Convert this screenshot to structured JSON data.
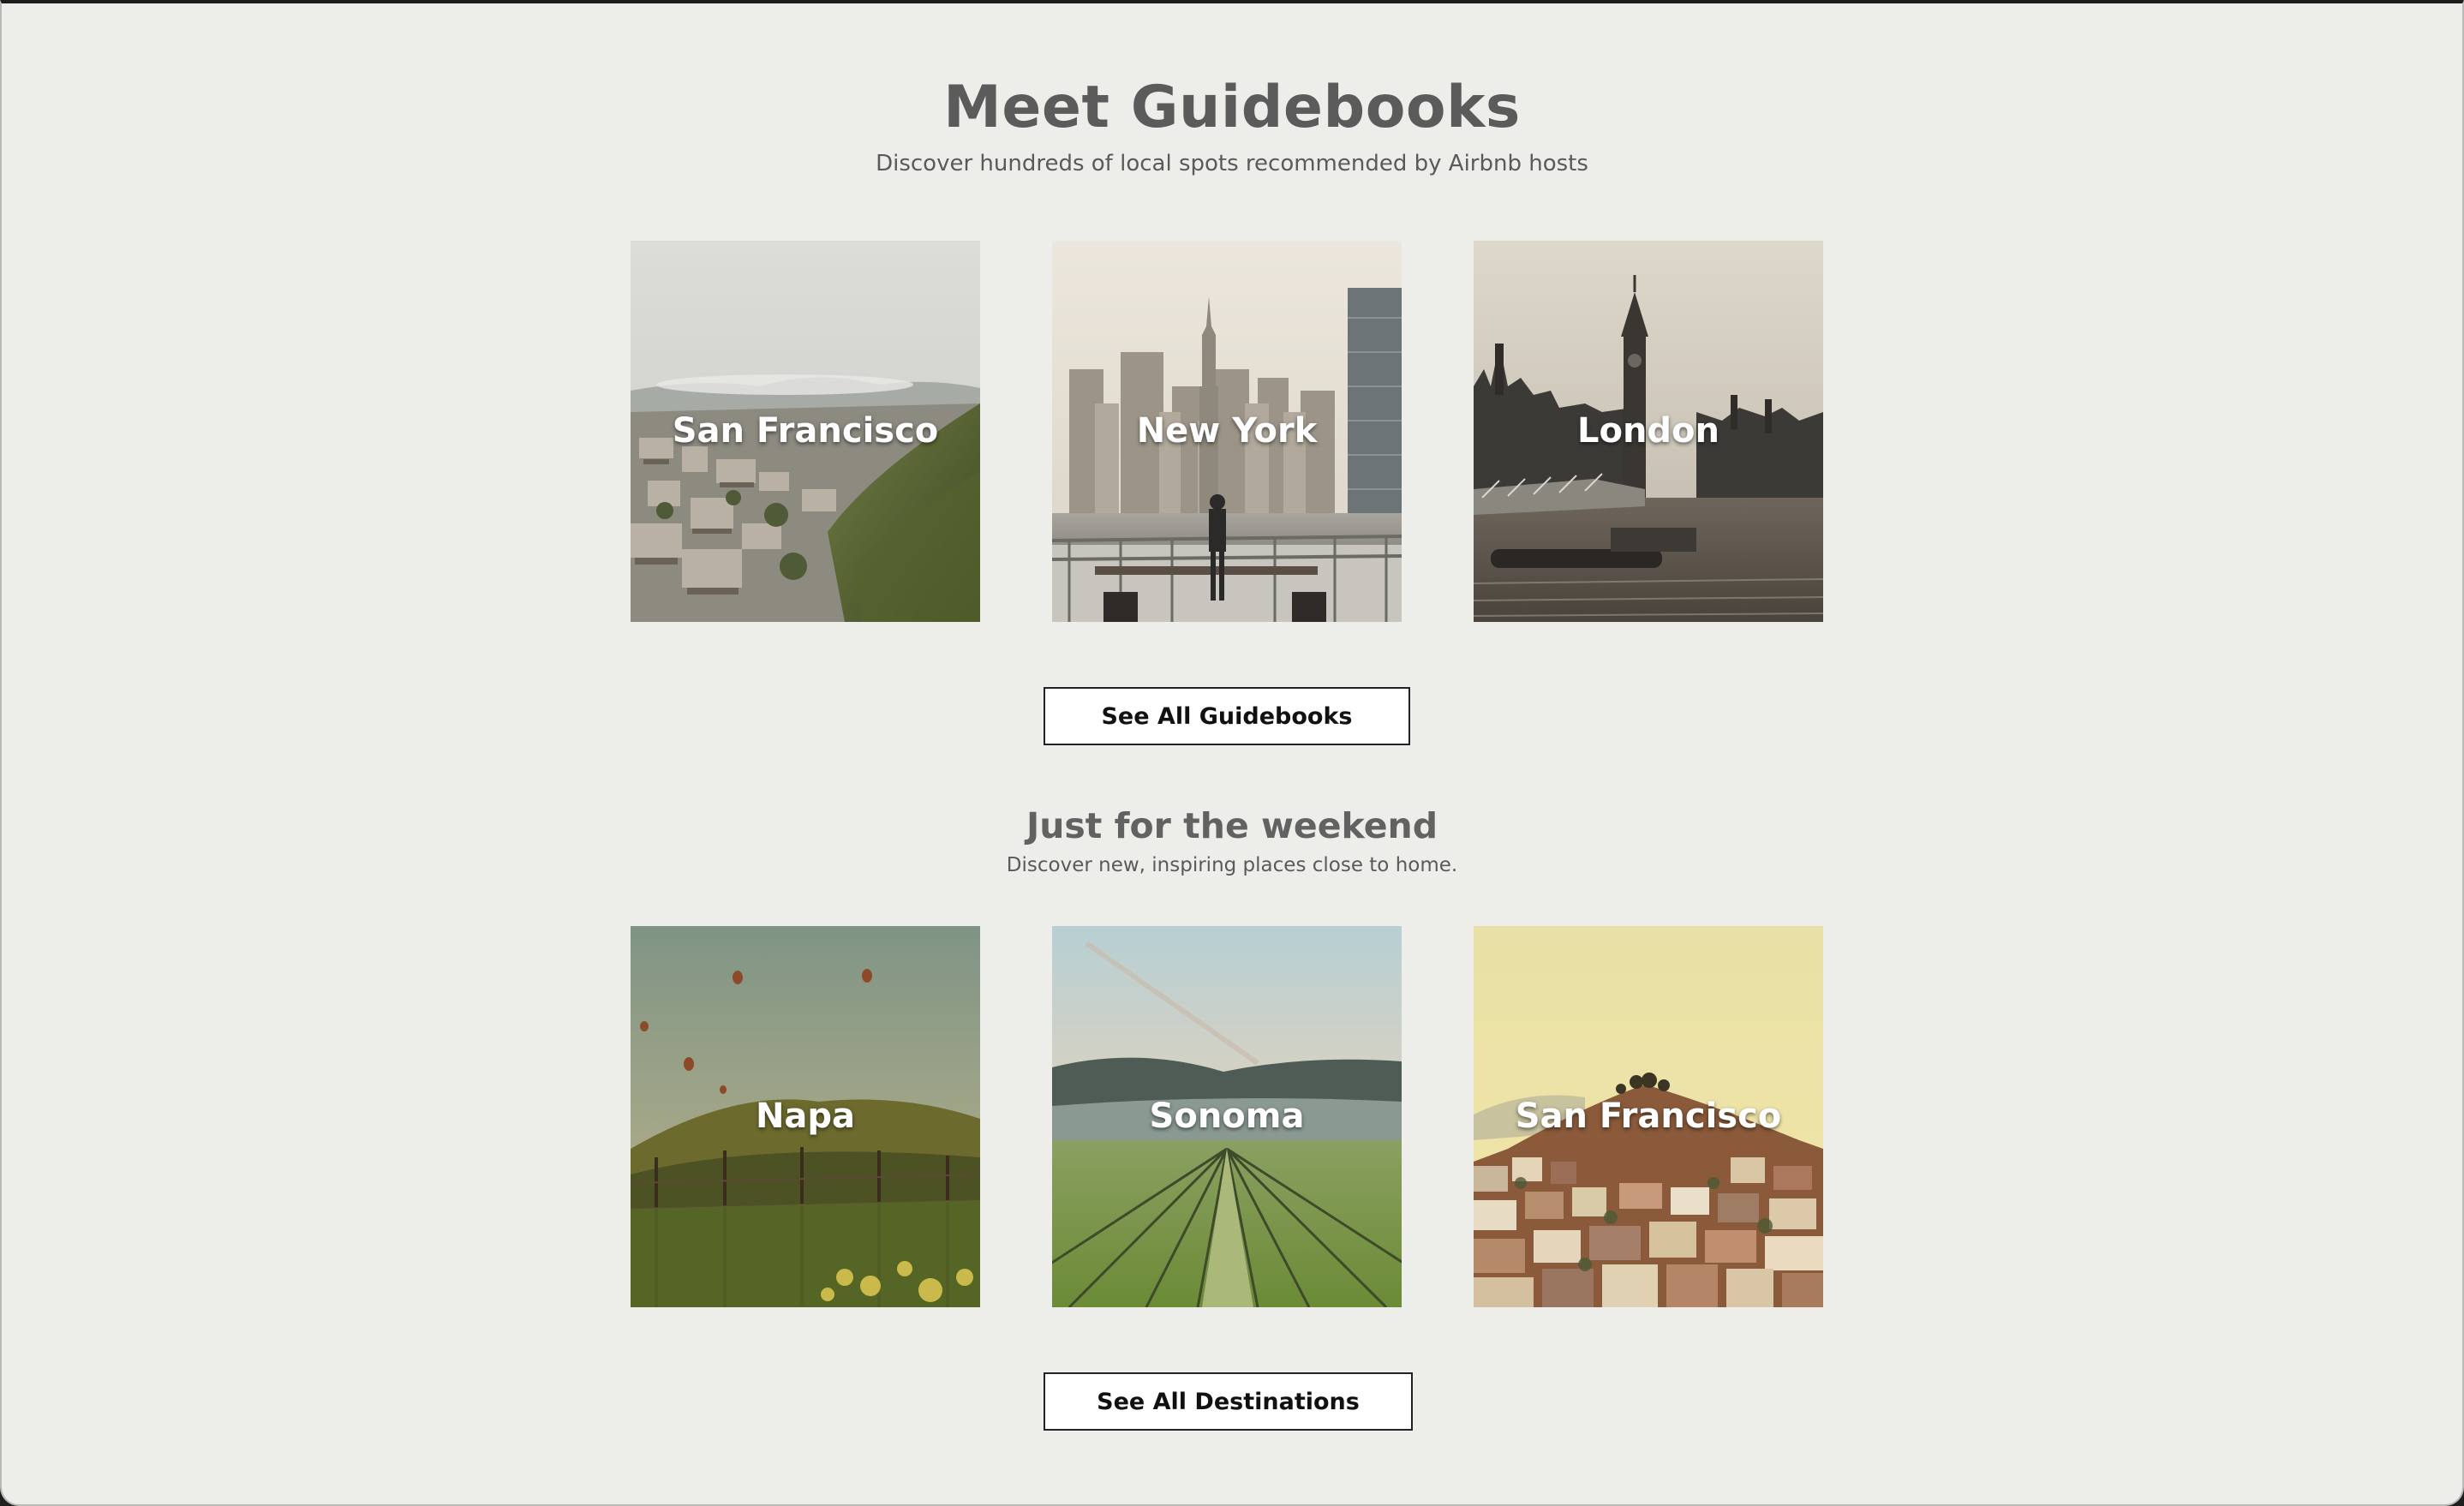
{
  "guidebooks": {
    "title": "Meet Guidebooks",
    "subtitle": "Discover hundreds of local spots recommended by Airbnb hosts",
    "cards": [
      {
        "label": "San Francisco"
      },
      {
        "label": "New York"
      },
      {
        "label": "London"
      }
    ],
    "button_label": "See All Guidebooks"
  },
  "weekend": {
    "title": "Just for the weekend",
    "subtitle": "Discover new, inspiring places close to home.",
    "cards": [
      {
        "label": "Napa"
      },
      {
        "label": "Sonoma"
      },
      {
        "label": "San Francisco"
      }
    ],
    "button_label": "See All Destinations"
  }
}
